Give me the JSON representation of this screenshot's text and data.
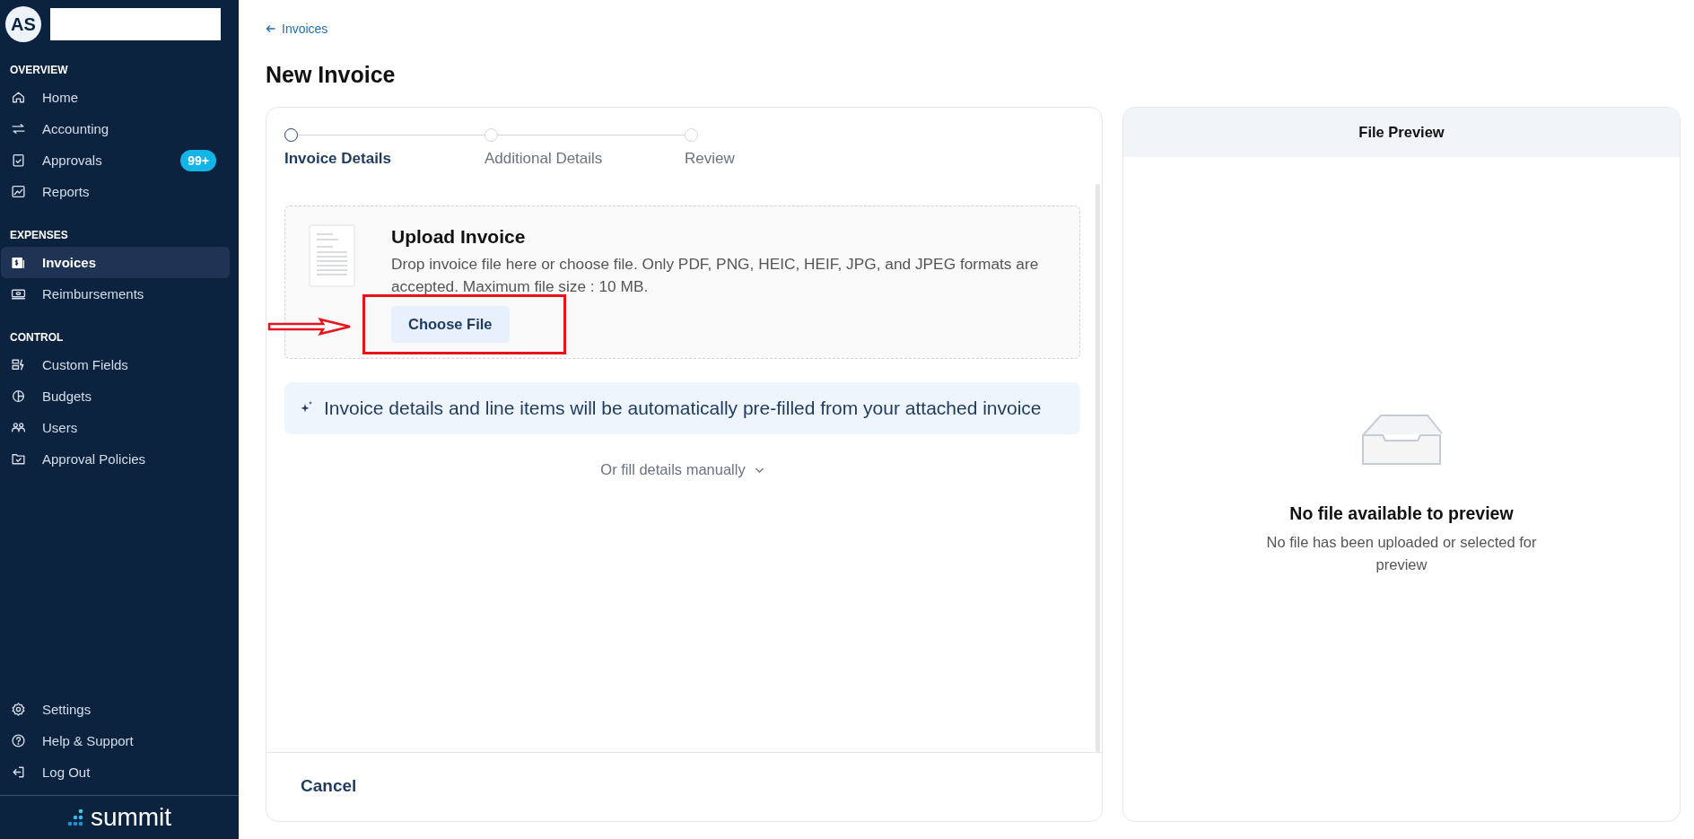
{
  "sidebar": {
    "avatar": "AS",
    "sections": [
      {
        "title": "OVERVIEW",
        "items": [
          {
            "label": "Home",
            "selected": false
          },
          {
            "label": "Accounting",
            "selected": false
          },
          {
            "label": "Approvals",
            "badge": "99+",
            "selected": false
          },
          {
            "label": "Reports",
            "selected": false
          }
        ]
      },
      {
        "title": "EXPENSES",
        "items": [
          {
            "label": "Invoices",
            "selected": true
          },
          {
            "label": "Reimbursements",
            "selected": false
          }
        ]
      },
      {
        "title": "CONTROL",
        "items": [
          {
            "label": "Custom Fields",
            "selected": false
          },
          {
            "label": "Budgets",
            "selected": false
          },
          {
            "label": "Users",
            "selected": false
          },
          {
            "label": "Approval Policies",
            "selected": false
          }
        ]
      }
    ],
    "footer_items": [
      {
        "label": "Settings"
      },
      {
        "label": "Help & Support"
      },
      {
        "label": "Log Out"
      }
    ],
    "logo": "summit"
  },
  "breadcrumb": "Invoices",
  "page_title": "New Invoice",
  "stepper": [
    {
      "label": "Invoice Details",
      "selected": true
    },
    {
      "label": "Additional Details",
      "selected": false
    },
    {
      "label": "Review",
      "selected": false
    }
  ],
  "upload": {
    "title": "Upload Invoice",
    "description": "Drop invoice file here or choose file. Only PDF, PNG, HEIC, HEIF, JPG, and JPEG formats are accepted. Maximum file size : 10 MB.",
    "button": "Choose File",
    "highlighted": true
  },
  "info_banner": "Invoice details and line items will be automatically pre-filled from your attached invoice",
  "manual_toggle": "Or fill details manually",
  "cancel_button": "Cancel",
  "preview": {
    "title": "File Preview",
    "empty_title": "No file available to preview",
    "empty_text": "No file has been uploaded or selected for preview"
  }
}
